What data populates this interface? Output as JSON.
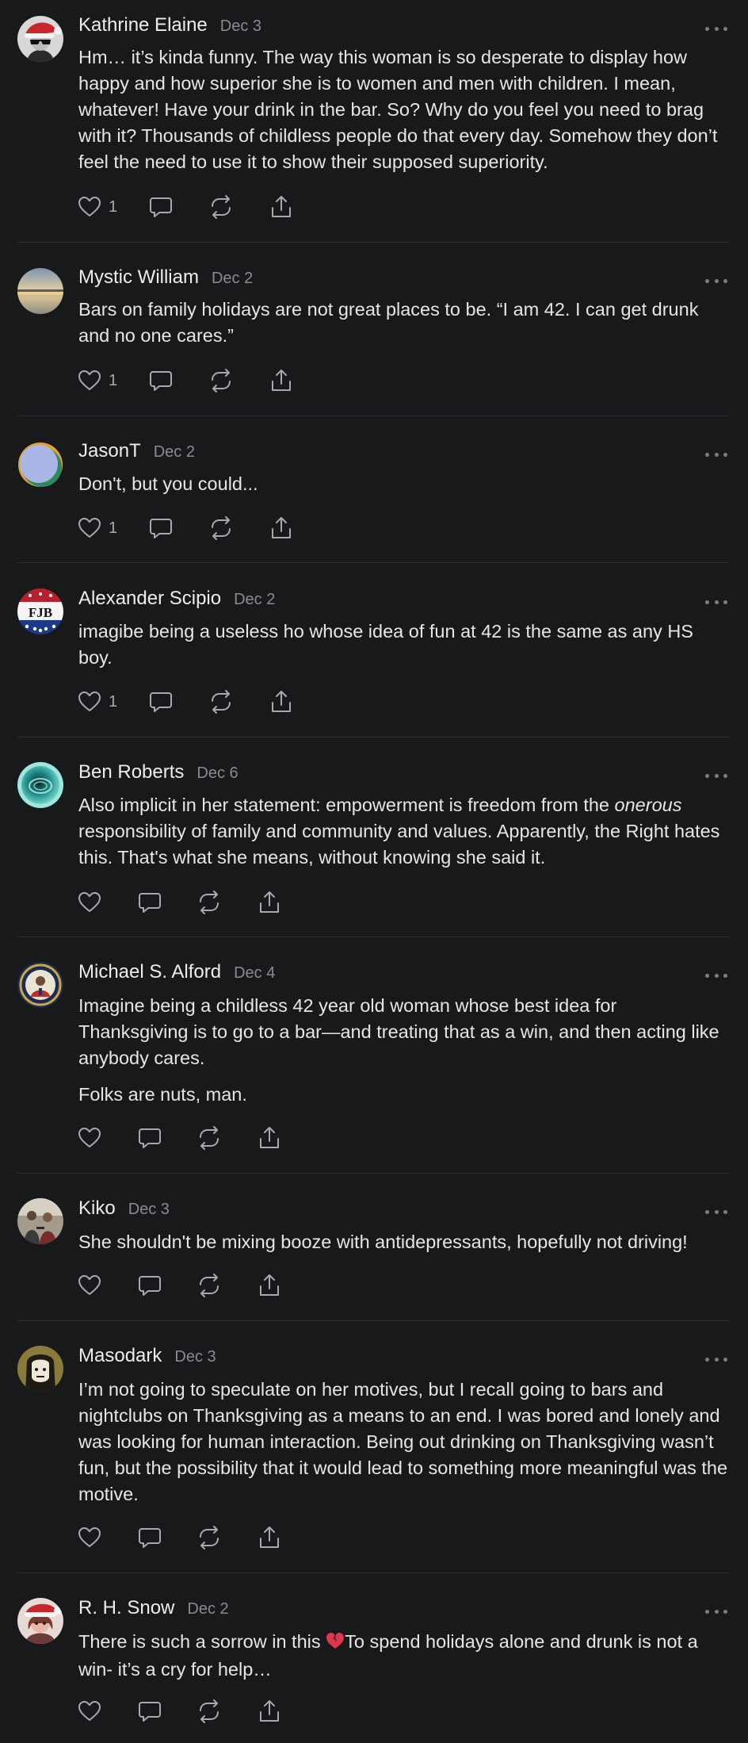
{
  "comments": [
    {
      "author": "Kathrine Elaine",
      "date": "Dec 3",
      "avatar": "santa-hat-sunglasses-avatar",
      "paragraphs": [
        "Hm… it’s kinda funny. The way this woman is so desperate to display how happy and how superior she is to women and men with children. I mean, whatever! Have your drink in the bar. So? Why do you feel you need to brag with it? Thousands of childless people do that every day. Somehow they don’t feel the need to use it to show their supposed superiority."
      ],
      "likes": "1"
    },
    {
      "author": "Mystic William",
      "date": "Dec 2",
      "avatar": "sunset-lake-avatar",
      "paragraphs": [
        "Bars on family holidays are not great places to be. “I am 42. I can get drunk and no one cares.”"
      ],
      "likes": "1"
    },
    {
      "author": "JasonT",
      "date": "Dec 2",
      "avatar": "circles-avatar",
      "paragraphs": [
        "Don't, but you could..."
      ],
      "likes": "1"
    },
    {
      "author": "Alexander Scipio",
      "date": "Dec 2",
      "avatar": "fjb-badge-avatar",
      "avatar_text": "FJB",
      "paragraphs": [
        "imagibe being a useless ho whose idea of fun at 42 is the same as any HS boy."
      ],
      "likes": "1"
    },
    {
      "author": "Ben Roberts",
      "date": "Dec 6",
      "avatar": "teal-orb-avatar",
      "paragraph_parts": {
        "before": "Also implicit in her statement: empowerment is freedom from the ",
        "emphasis": "onerous",
        "after": " responsibility of family and community and values. Apparently, the Right hates this. That's what she means, without knowing she said it."
      },
      "likes": ""
    },
    {
      "author": "Michael S. Alford",
      "date": "Dec 4",
      "avatar": "seal-portrait-avatar",
      "paragraphs": [
        "Imagine being a childless 42 year old woman whose best idea for Thanksgiving is to go to a bar—and treating that as a win, and then acting like anybody cares.",
        "Folks are nuts, man."
      ],
      "likes": ""
    },
    {
      "author": "Kiko",
      "date": "Dec 3",
      "avatar": "people-photo-avatar",
      "paragraphs": [
        "She shouldn't be mixing booze with antidepressants, hopefully not driving!"
      ],
      "likes": ""
    },
    {
      "author": "Masodark",
      "date": "Dec 3",
      "avatar": "cartoon-face-avatar",
      "paragraphs": [
        "I’m not going to speculate on her motives, but I recall going to bars and nightclubs on Thanksgiving as a means to an end. I was bored and lonely and was looking for human interaction. Being out drinking on Thanksgiving wasn’t fun, but the possibility that it would lead to something more meaningful was the motive."
      ],
      "likes": ""
    },
    {
      "author": "R. H. Snow",
      "date": "Dec 2",
      "avatar": "santa-hat-woman-avatar",
      "paragraph_parts": {
        "before": "There is such a sorrow in this ",
        "emoji": "💔",
        "after": "To spend holidays alone and drunk is not a win- it’s a cry for help…"
      },
      "likes": ""
    }
  ],
  "icons": {
    "like": "heart-icon",
    "reply": "comment-bubble-icon",
    "restack": "restack-arrows-icon",
    "share": "share-icon",
    "menu": "more-dots-icon"
  },
  "colors": {
    "background": "#18191b",
    "text": "#e6e6e6",
    "muted": "#8a8b8f",
    "icon": "#a8a9ad",
    "divider": "#2d2e31",
    "broken_heart": "#e0364c"
  }
}
